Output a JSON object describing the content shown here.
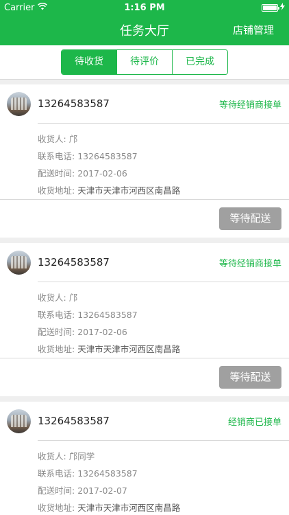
{
  "status_bar": {
    "carrier": "Carrier",
    "time": "1:16 PM"
  },
  "nav": {
    "title": "任务大厅",
    "right_label": "店铺管理"
  },
  "tabs": [
    {
      "label": "待收货",
      "active": true
    },
    {
      "label": "待评价",
      "active": false
    },
    {
      "label": "已完成",
      "active": false
    }
  ],
  "labels": {
    "receiver": "收货人:",
    "contact": "联系电话:",
    "delivery_time": "配送时间:",
    "address": "收货地址:"
  },
  "orders": [
    {
      "phone": "13264583587",
      "status": "等待经销商接单",
      "receiver": "邝",
      "contact": "13264583587",
      "delivery_time": "2017-02-06",
      "address": "天津市天津市河西区南昌路",
      "action": "等待配送"
    },
    {
      "phone": "13264583587",
      "status": "等待经销商接单",
      "receiver": "邝",
      "contact": "13264583587",
      "delivery_time": "2017-02-06",
      "address": "天津市天津市河西区南昌路",
      "action": "等待配送"
    },
    {
      "phone": "13264583587",
      "status": "经销商已接单",
      "receiver": "邝同学",
      "contact": "13264583587",
      "delivery_time": "2017-02-07",
      "address": "天津市天津市河西区南昌路"
    }
  ],
  "colors": {
    "brand_green": "#1db74a",
    "button_grey": "#a0a0a0",
    "muted_text": "#8a8a8a"
  }
}
